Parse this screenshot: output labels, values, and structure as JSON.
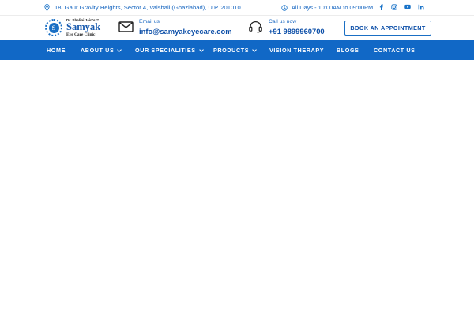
{
  "topbar": {
    "address": "18, Gaur Gravity Heights, Sector 4, Vaishali (Ghaziabad), U.P. 201010",
    "hours": "All Days - 10:00AM to 09:00PM",
    "social": [
      "facebook-icon",
      "instagram-icon",
      "youtube-icon",
      "linkedin-icon"
    ]
  },
  "logo": {
    "tagline": "Dr. Shalini Jain's™",
    "name": "Samyak",
    "subtitle": "Eye Care Clinic",
    "mark_letter": "S"
  },
  "contact": {
    "email_label": "Email us",
    "email": "info@samyakeyecare.com",
    "phone_label": "Call us now",
    "phone": "+91 9899960700"
  },
  "cta": {
    "book_label": "BOOK AN APPOINTMENT"
  },
  "nav": {
    "items": [
      {
        "label": "HOME",
        "dropdown": false
      },
      {
        "label": "ABOUT US",
        "dropdown": true
      },
      {
        "label": "OUR SPECIALITIES",
        "dropdown": true
      },
      {
        "label": "PRODUCTS",
        "dropdown": true
      },
      {
        "label": "VISION THERAPY",
        "dropdown": false
      },
      {
        "label": "BLOGS",
        "dropdown": false
      },
      {
        "label": "CONTACT US",
        "dropdown": false
      }
    ]
  },
  "colors": {
    "brand_blue": "#1168c6",
    "text_blue": "#0d4fa8",
    "accent_blue": "#1565c0"
  }
}
